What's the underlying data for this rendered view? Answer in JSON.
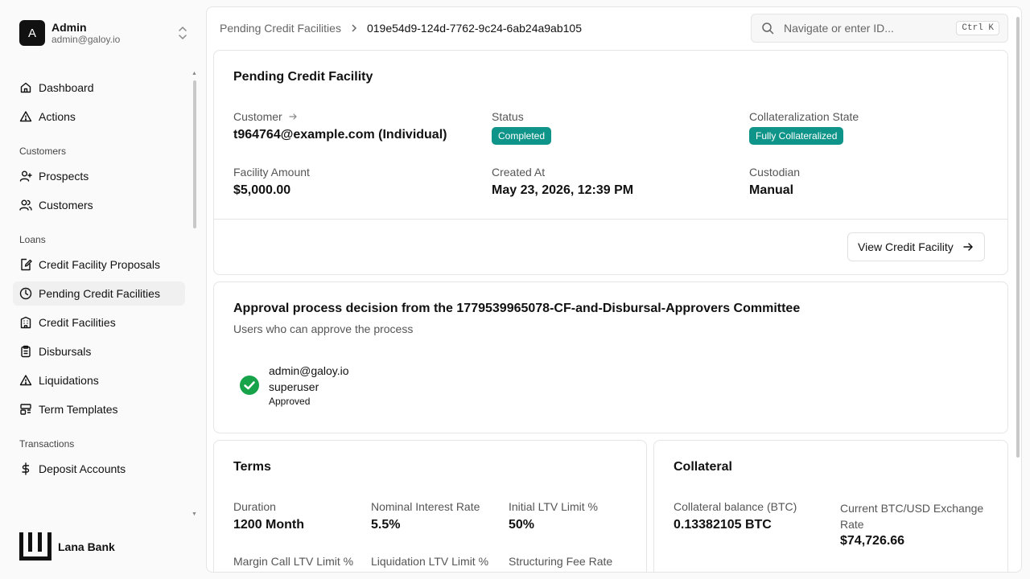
{
  "user": {
    "initial": "A",
    "name": "Admin",
    "email": "admin@galoy.io"
  },
  "nav": {
    "dashboard": "Dashboard",
    "actions": "Actions",
    "customers_section": "Customers",
    "prospects": "Prospects",
    "customers": "Customers",
    "loans_section": "Loans",
    "proposals": "Credit Facility Proposals",
    "pending": "Pending Credit Facilities",
    "facilities": "Credit Facilities",
    "disbursals": "Disbursals",
    "liquidations": "Liquidations",
    "term_templates": "Term Templates",
    "transactions_section": "Transactions",
    "deposit_accounts": "Deposit Accounts"
  },
  "brand": {
    "name": "Lana Bank"
  },
  "breadcrumb": {
    "parent": "Pending Credit Facilities",
    "current": "019e54d9-124d-7762-9c24-6ab24a9ab105"
  },
  "search": {
    "placeholder": "Navigate or enter ID...",
    "shortcut": "Ctrl K"
  },
  "facility": {
    "title": "Pending Credit Facility",
    "customer_label": "Customer",
    "customer_value": "t964764@example.com (Individual)",
    "status_label": "Status",
    "status_value": "Completed",
    "collat_state_label": "Collateralization State",
    "collat_state_value": "Fully Collateralized",
    "amount_label": "Facility Amount",
    "amount_value": "$5,000.00",
    "created_label": "Created At",
    "created_value": "May 23, 2026, 12:39 PM",
    "custodian_label": "Custodian",
    "custodian_value": "Manual",
    "view_button": "View Credit Facility"
  },
  "approval": {
    "title": "Approval process decision from the 1779539965078-CF-and-Disbursal-Approvers Committee",
    "subtitle": "Users who can approve the process",
    "approver_email": "admin@galoy.io",
    "approver_role": "superuser",
    "approver_status": "Approved"
  },
  "terms": {
    "title": "Terms",
    "duration_label": "Duration",
    "duration_value": "1200 Month",
    "interest_label": "Nominal Interest Rate",
    "interest_value": "5.5%",
    "ltv_label": "Initial LTV Limit %",
    "ltv_value": "50%",
    "margin_label": "Margin Call LTV Limit %",
    "liquidation_label": "Liquidation LTV Limit %",
    "fee_label": "Structuring Fee Rate"
  },
  "collateral": {
    "title": "Collateral",
    "balance_label": "Collateral balance (BTC)",
    "balance_value": "0.13382105 BTC",
    "rate_label": "Current BTC/USD Exchange Rate",
    "rate_value": "$74,726.66"
  },
  "colors": {
    "accent": "#0e9488",
    "approved": "#16a34a"
  }
}
